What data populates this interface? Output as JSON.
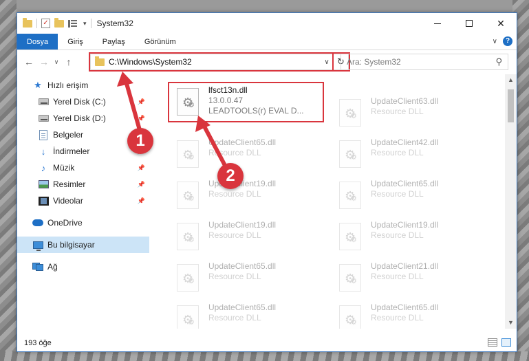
{
  "window": {
    "title": "System32",
    "controls": {
      "minimize": "minimize",
      "maximize": "maximize",
      "close": "✕"
    }
  },
  "ribbon": {
    "tabs": [
      "Dosya",
      "Giriş",
      "Paylaş",
      "Görünüm"
    ]
  },
  "nav": {
    "address": "C:\\Windows\\System32",
    "search_placeholder": "Ara: System32"
  },
  "sidebar": {
    "quick_access": "Hızlı erişim",
    "items": [
      {
        "label": "Yerel Disk (C:)",
        "icon": "disk-icon",
        "pinned": true
      },
      {
        "label": "Yerel Disk (D:)",
        "icon": "disk-icon",
        "pinned": true
      },
      {
        "label": "Belgeler",
        "icon": "documents-icon",
        "pinned": true
      },
      {
        "label": "İndirmeler",
        "icon": "download-icon",
        "pinned": true
      },
      {
        "label": "Müzik",
        "icon": "music-icon",
        "pinned": true
      },
      {
        "label": "Resimler",
        "icon": "pictures-icon",
        "pinned": true
      },
      {
        "label": "Videolar",
        "icon": "videos-icon",
        "pinned": true
      }
    ],
    "onedrive": "OneDrive",
    "this_pc": "Bu bilgisayar",
    "network": "Ağ"
  },
  "files": {
    "highlighted": {
      "name": "lfsct13n.dll",
      "version": "13.0.0.47",
      "description": "LEADTOOLS(r) EVAL D..."
    },
    "left_column": [
      {
        "name": "UpdateClient65.dll",
        "type": "Resource DLL"
      },
      {
        "name": "UpdateClient19.dll",
        "type": "Resource DLL"
      },
      {
        "name": "UpdateClient19.dll",
        "type": "Resource DLL"
      },
      {
        "name": "UpdateClient65.dll",
        "type": "Resource DLL"
      },
      {
        "name": "UpdateClient65.dll",
        "type": "Resource DLL"
      }
    ],
    "right_column": [
      {
        "name": "UpdateClient63.dll",
        "type": "Resource DLL"
      },
      {
        "name": "UpdateClient42.dll",
        "type": "Resource DLL"
      },
      {
        "name": "UpdateClient65.dll",
        "type": "Resource DLL"
      },
      {
        "name": "UpdateClient19.dll",
        "type": "Resource DLL"
      },
      {
        "name": "UpdateClient21.dll",
        "type": "Resource DLL"
      },
      {
        "name": "UpdateClient65.dll",
        "type": "Resource DLL"
      }
    ]
  },
  "status": {
    "item_count": "193 öğe"
  },
  "annotations": {
    "step1": "1",
    "step2": "2",
    "color": "#d9353d"
  }
}
